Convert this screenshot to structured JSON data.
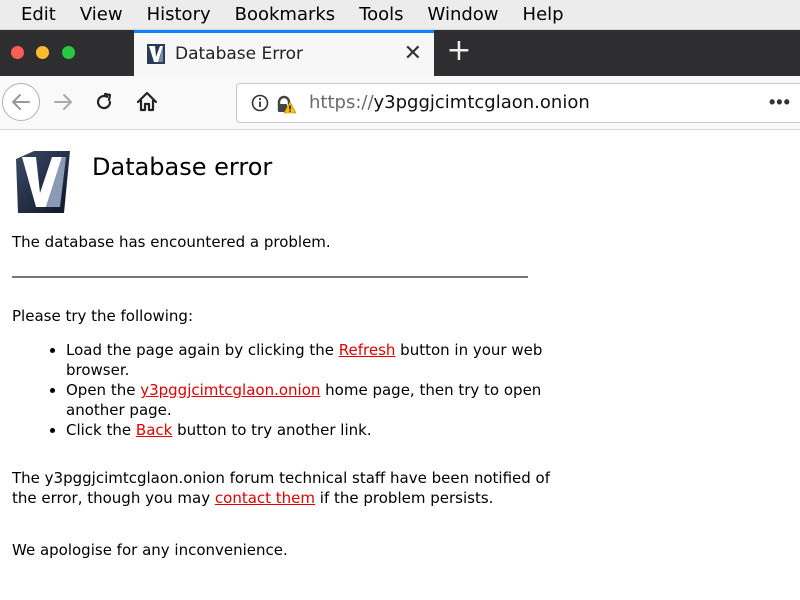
{
  "menubar": {
    "items": [
      "Edit",
      "View",
      "History",
      "Bookmarks",
      "Tools",
      "Window",
      "Help"
    ]
  },
  "tab": {
    "title": "Database Error",
    "close_label": "✕",
    "new_tab_label": "+"
  },
  "toolbar": {
    "url_scheme": "https://",
    "url_host": "y3pggjcimtcglaon.onion",
    "more_label": "•••",
    "icons": [
      "back-arrow-icon",
      "forward-arrow-icon",
      "reload-icon",
      "home-icon",
      "info-icon",
      "tracking-warning-icon",
      "more-icon"
    ]
  },
  "page": {
    "title": "Database error",
    "intro": "The database has encountered a problem.",
    "try_heading": "Please try the following:",
    "suggestions": [
      {
        "before": "Load the page again by clicking the ",
        "link": "Refresh",
        "after": " button in your web browser."
      },
      {
        "before": "Open the ",
        "link": "y3pggjcimtcglaon.onion",
        "after": " home page, then try to open another page."
      },
      {
        "before": "Click the ",
        "link": "Back",
        "after": " button to try another link."
      }
    ],
    "notice_before": "The y3pggjcimtcglaon.onion forum technical staff have been notified of the error, though you may ",
    "notice_link": "contact them",
    "notice_after": " if the problem persists.",
    "apology": "We apologise for any inconvenience."
  },
  "colors": {
    "link": "#e10000",
    "tab_accent": "#0a84ff",
    "tabstrip_bg": "#2e2e30"
  }
}
